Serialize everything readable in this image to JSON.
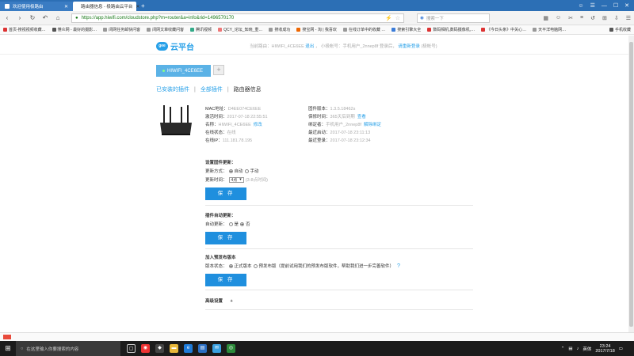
{
  "browser": {
    "tabs": [
      {
        "title": "欢迎使用极路由"
      },
      {
        "title": "路由器信息 - 极路由云平台"
      }
    ],
    "new_tab": "+",
    "url": "https://app.hiwifi.com/cloudstore.php?m=router&a=info&rid=1496570170",
    "search_placeholder": "搜索一下",
    "bookmarks": [
      "首页-搜视视频收藏…",
      "懂众网 - 最好的摄影…",
      "闭网任务邮快问客",
      "闭网文章收藏问客",
      "腾讯视频",
      "QCY_论坛_知晓_重…",
      "搜收成功",
      "搜宝网 - 淘 | 我喜欢",
      "在线订单中的收藏 …",
      "搜索引擎大全",
      "数码相机,数码摄像机,…",
      "《今日头条》中关心…",
      "天平洋电脑网…",
      "手机收藏"
    ]
  },
  "site": {
    "logo_badge": "gee",
    "logo_text": "云平台",
    "userbar": {
      "device_prefix": "当前路由：HIWIFI_4CE6EE",
      "logout": "退出",
      "account": "小极帐号：手机用户_2nnep8f",
      "login_prompt": "登录后，",
      "relogin": "请重新登录",
      "suffix": "(极帐号)"
    },
    "device_tab": "HIWIFI_4CE6EE",
    "add_tab": "+",
    "subnav": {
      "installed": "已安装的插件",
      "all": "全部插件",
      "sep": "|",
      "current": "路由器信息"
    },
    "info": {
      "rows": [
        [
          {
            "k": "MAC地址：",
            "v": "D4EE074CE6EE",
            "link": ""
          },
          {
            "k": "固件版本：",
            "v": "1.3.5.18462s",
            "link": ""
          }
        ],
        [
          {
            "k": "激活时间：",
            "v": "2017-07-18 22:55:51",
            "link": ""
          },
          {
            "k": "保修时间：",
            "v": "365天后到期",
            "link": "查看"
          }
        ],
        [
          {
            "k": "名称：",
            "v": "HIWIFI_4CE6EE",
            "link": "修改"
          },
          {
            "k": "绑定者：",
            "v": "手机用户_2nnep8f",
            "link": "解除绑定"
          }
        ],
        [
          {
            "k": "在线状态：",
            "v": "在线",
            "link": ""
          },
          {
            "k": "最近启动：",
            "v": "2017-07-18 23:11:13",
            "link": ""
          }
        ],
        [
          {
            "k": "在线IP：",
            "v": "111.181.78.195",
            "link": ""
          },
          {
            "k": "最近登录：",
            "v": "2017-07-18 23:12:34",
            "link": ""
          }
        ]
      ]
    },
    "firmware_update": {
      "heading": "设置固件更新：",
      "mode_label": "更新方式：",
      "opt_auto": "自动",
      "opt_manual": "手动",
      "time_label": "更新时间：",
      "time_value": "4点",
      "time_hint": "(3-8点时间)",
      "save": "保 存"
    },
    "plugin_update": {
      "heading": "插件自动更新：",
      "label": "自动更新：",
      "opt_yes": "是",
      "opt_no": "否",
      "save": "保 存"
    },
    "preview": {
      "heading": "加入预发布版本",
      "label": "版本状态：",
      "opt_formal": "正式版本",
      "opt_preview": "预发布版（提前试用我们的预发布版软件，帮助我们进一步完善软件）",
      "help": "?",
      "save": "保 存"
    },
    "advanced": {
      "label": "高级设置",
      "toggle": "+"
    }
  },
  "taskbar": {
    "search_placeholder": "在这里输入你要搜索的内容",
    "lang": "英体",
    "time": "23:24",
    "date": "2017/7/18"
  },
  "colors": {
    "accent": "#27a0e8",
    "button": "#1f8fde",
    "tabbar": "#2c6fb5"
  }
}
